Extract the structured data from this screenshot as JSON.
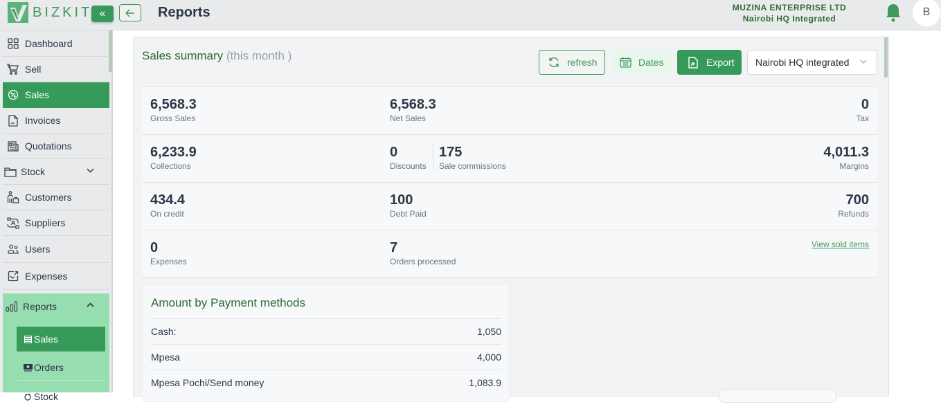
{
  "app": {
    "brand": "BIZKIT",
    "page_title": "Reports"
  },
  "header": {
    "company": "MUZINA ENTERPRISE LTD",
    "branch": "Nairobi HQ Integrated",
    "avatar_initial": "B",
    "icons": {
      "collapse": "chevrons-left-icon",
      "back": "arrow-left-icon",
      "notifications": "bell-icon"
    }
  },
  "sidebar": {
    "items": [
      {
        "label": "Dashboard",
        "icon": "grid-icon"
      },
      {
        "label": "Sell",
        "icon": "cart-icon"
      },
      {
        "label": "Sales",
        "icon": "percent-badge-icon",
        "active": true
      },
      {
        "label": "Invoices",
        "icon": "document-icon"
      },
      {
        "label": "Quotations",
        "icon": "newspaper-icon"
      },
      {
        "label": "Stock",
        "icon": "folder-icon",
        "expandable": true,
        "expanded": false
      },
      {
        "label": "Customers",
        "icon": "customer-icon"
      },
      {
        "label": "Suppliers",
        "icon": "supplier-icon"
      },
      {
        "label": "Users",
        "icon": "users-icon"
      },
      {
        "label": "Expenses",
        "icon": "expense-icon"
      }
    ],
    "reports": {
      "label": "Reports",
      "icon": "bar-chart-icon",
      "expanded": true,
      "sub_items": [
        {
          "label": "Sales",
          "icon": "list-icon",
          "active": true
        },
        {
          "label": "Orders",
          "icon": "cash-icon"
        },
        {
          "label": "Stock",
          "icon": "stock-icon"
        }
      ]
    }
  },
  "summary": {
    "title": "Sales summary",
    "period": "(this month )",
    "buttons": {
      "refresh": "refresh",
      "dates": "Dates",
      "export": "Export"
    },
    "branch_select": {
      "value": "Nairobi HQ integrated"
    },
    "rows": [
      {
        "left": {
          "value": "6,568.3",
          "label": "Gross Sales"
        },
        "mid": {
          "value": "6,568.3",
          "label": "Net Sales"
        },
        "right": {
          "value": "0",
          "label": "Tax"
        }
      },
      {
        "left": {
          "value": "6,233.9",
          "label": "Collections"
        },
        "mid": {
          "value": "0",
          "label": "Discounts"
        },
        "mid2": {
          "value": "175",
          "label": "Sale commissions"
        },
        "right": {
          "value": "4,011.3",
          "label": "Margins"
        }
      },
      {
        "left": {
          "value": "434.4",
          "label": "On credit"
        },
        "mid": {
          "value": "100",
          "label": "Debt Paid"
        },
        "right": {
          "value": "700",
          "label": "Refunds"
        }
      },
      {
        "left": {
          "value": "0",
          "label": "Expenses"
        },
        "mid": {
          "value": "7",
          "label": "Orders processed"
        },
        "link": "View sold items"
      }
    ]
  },
  "payment_methods": {
    "title": "Amount by Payment methods",
    "rows": [
      {
        "method": "Cash:",
        "amount": "1,050"
      },
      {
        "method": "Mpesa",
        "amount": "4,000"
      },
      {
        "method": "Mpesa Pochi/Send money",
        "amount": "1,083.9"
      }
    ]
  },
  "colors": {
    "brand_green": "#369a5a",
    "title_green": "#2e6b33",
    "reports_bg": "#96deb0"
  }
}
